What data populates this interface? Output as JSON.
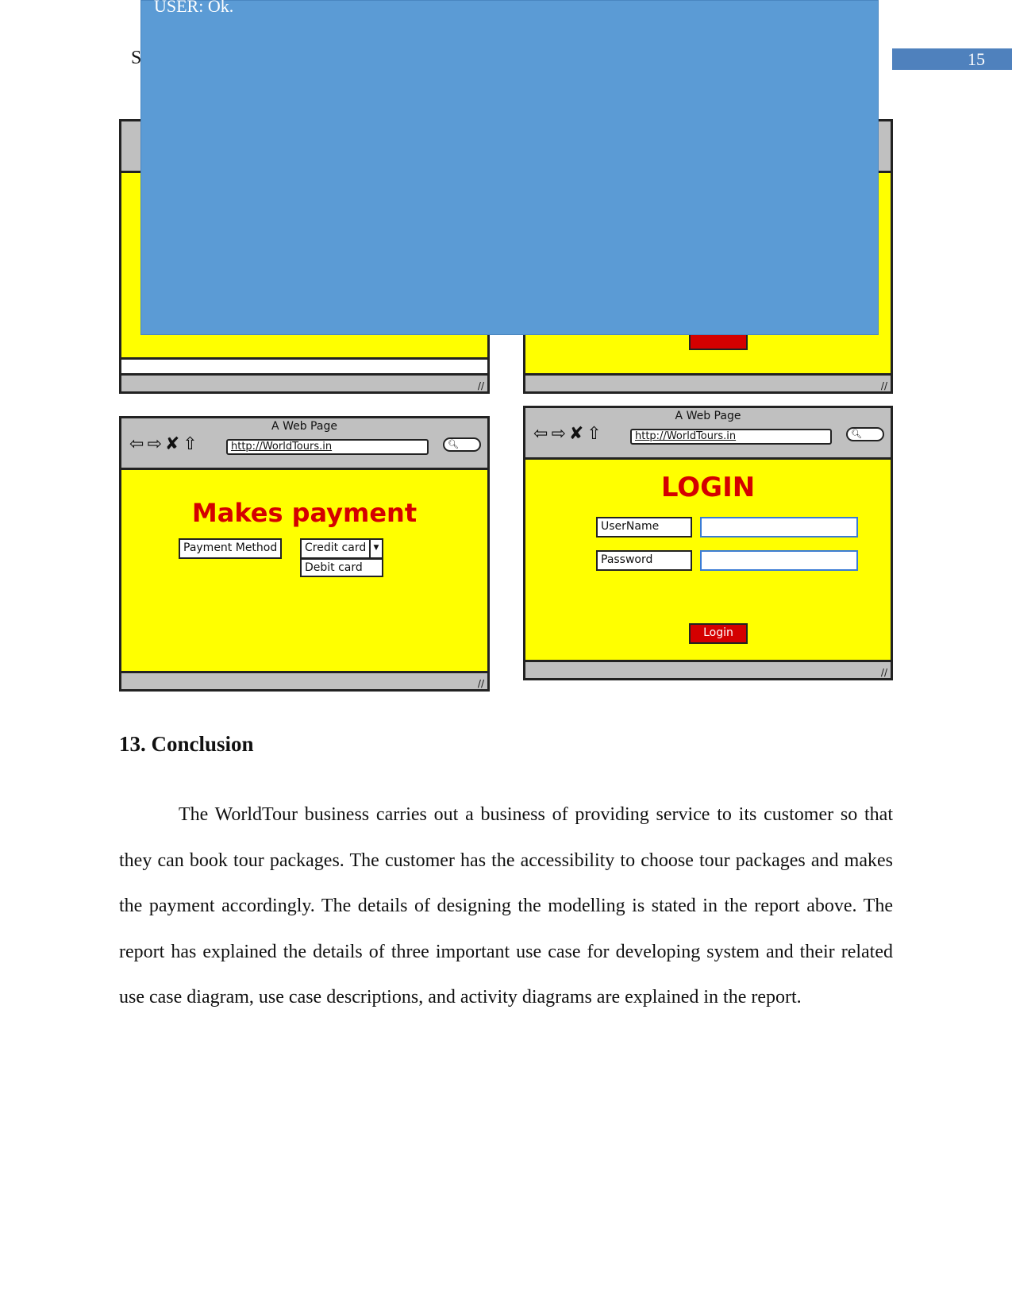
{
  "header": {
    "partial_letter": "S",
    "page_number": "15"
  },
  "overlay": {
    "text": "USER: Ok.",
    "color": "#5b9bd5"
  },
  "wireframes": {
    "window_title": "A Web Page",
    "url": "http://WorldTours.in",
    "nav_icons": [
      "back-arrow-icon",
      "forward-arrow-icon",
      "close-icon",
      "home-icon"
    ],
    "payment": {
      "heading": "Makes payment",
      "method_label": "Payment Method",
      "options": [
        "Credit card",
        "Debit card"
      ]
    },
    "login": {
      "heading": "LOGIN",
      "username_label": "UserName",
      "password_label": "Password",
      "button": "Login"
    }
  },
  "section": {
    "heading": "13. Conclusion",
    "body": "The WorldTour business carries out a business of providing service to its customer so that they can book tour packages. The customer has the accessibility to choose tour packages and makes the payment accordingly. The details of designing the modelling is stated in the report above. The report has explained the details of three important use case for developing system and their related use case diagram, use case descriptions, and activity diagrams are explained in the report."
  }
}
